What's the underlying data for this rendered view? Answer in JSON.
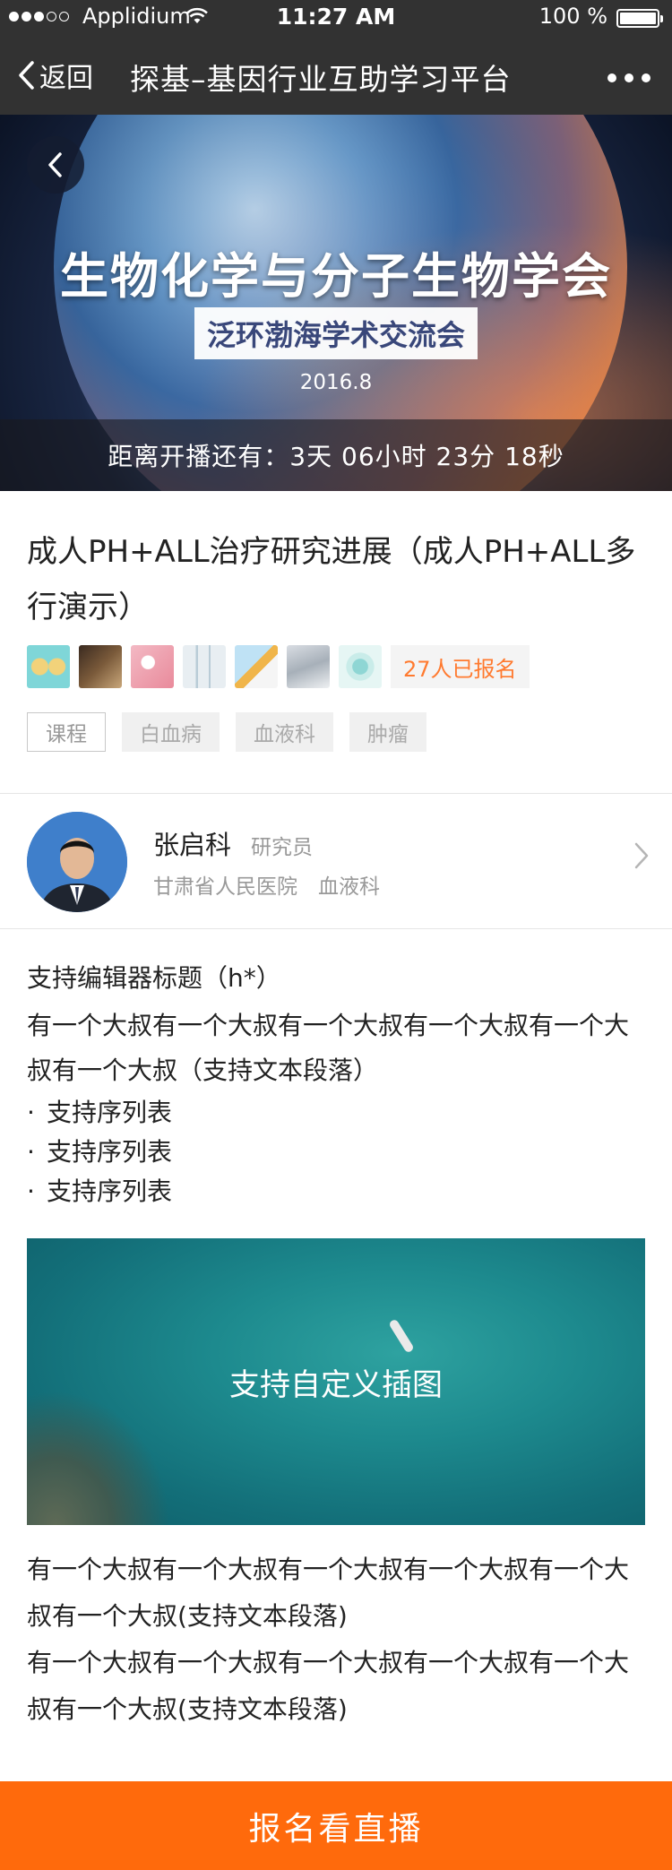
{
  "status_bar": {
    "carrier": "Applidium",
    "time": "11:27 AM",
    "battery": "100 %"
  },
  "nav": {
    "back_label": "返回",
    "title": "探基–基因行业互助学习平台"
  },
  "banner": {
    "main_title": "生物化学与分子生物学会",
    "sub_title": "泛环渤海学术交流会",
    "date": "2016.8",
    "countdown": "距离开播还有：3天 06小时 23分 18秒"
  },
  "course": {
    "title": "成人PH+ALL治疗研究进展（成人PH+ALL多行演示）",
    "registered_count": "27人已报名",
    "tags": [
      "课程",
      "白血病",
      "血液科",
      "肿瘤"
    ]
  },
  "speaker": {
    "name": "张启科",
    "role": "研究员",
    "hospital": "甘肃省人民医院　血液科"
  },
  "content": {
    "heading": "支持编辑器标题（h*）",
    "paragraph": "有一个大叔有一个大叔有一个大叔有一个大叔有一个大叔有一个大叔（支持文本段落）",
    "list_bullet": "·",
    "list_items": [
      "支持序列表",
      "支持序列表",
      "支持序列表"
    ],
    "illustration_caption": "支持自定义插图",
    "paragraph_2": "有一个大叔有一个大叔有一个大叔有一个大叔有一个大叔有一个大叔(支持文本段落)",
    "paragraph_3": "有一个大叔有一个大叔有一个大叔有一个大叔有一个大叔有一个大叔(支持文本段落)"
  },
  "cta": {
    "label": "报名看直播"
  },
  "colors": {
    "accent": "#ff6a0c",
    "count_text": "#ff7a2f",
    "nav_bg": "#323232"
  }
}
